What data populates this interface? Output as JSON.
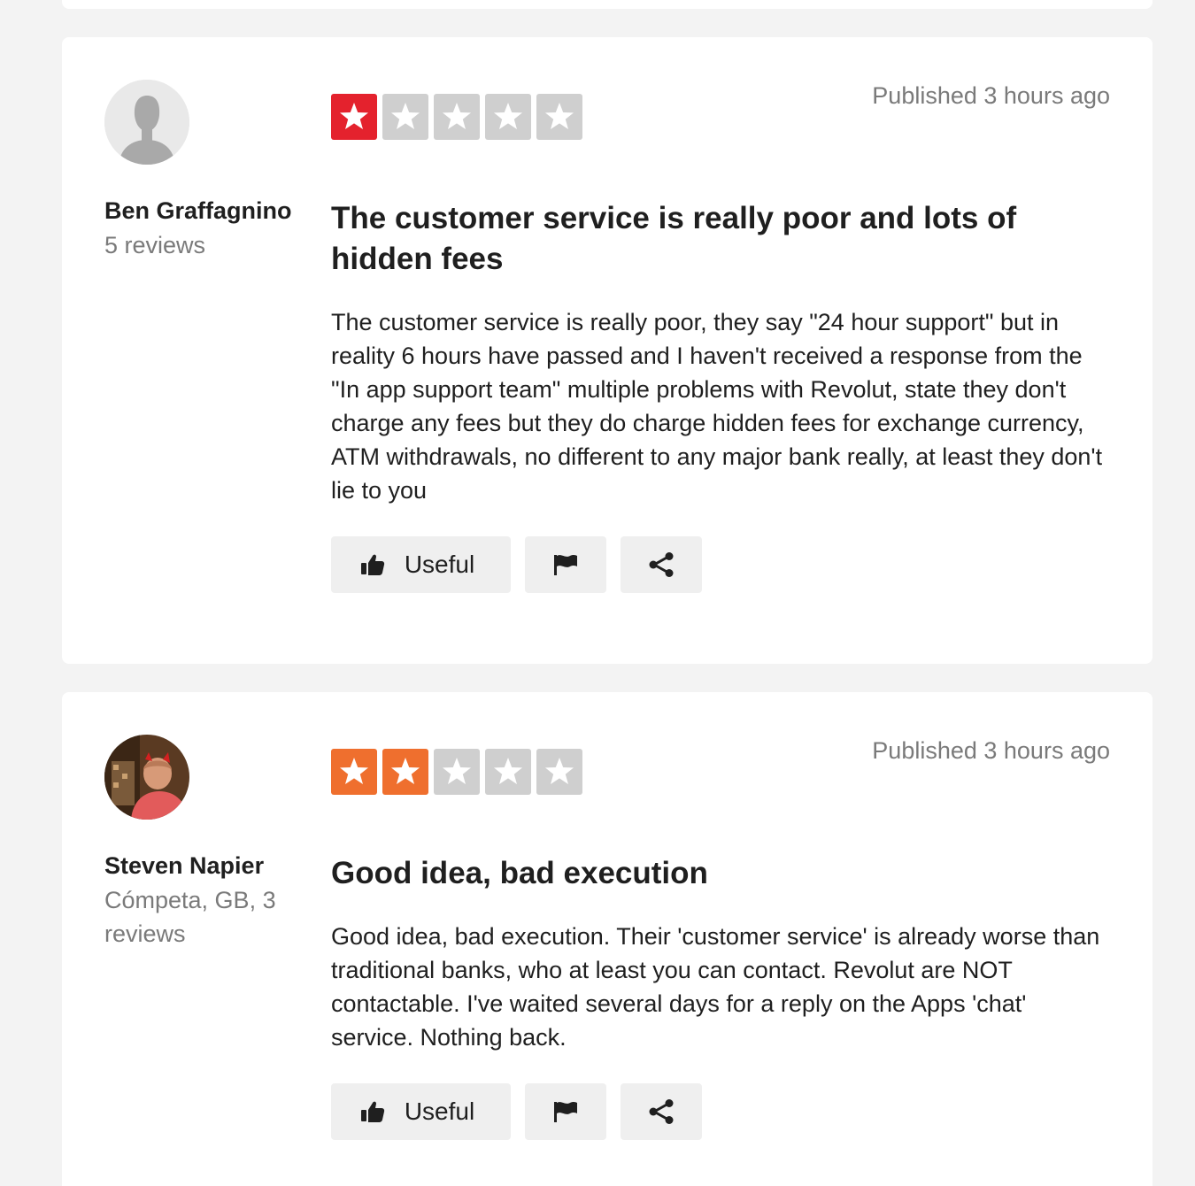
{
  "reviews": [
    {
      "reviewer_name": "Ben Graffagnino",
      "reviewer_meta": "5 reviews",
      "avatar": "default-silhouette",
      "rating": 1,
      "rating_max": 5,
      "rating_color": "#e4222d",
      "published": "Published 3 hours ago",
      "title": "The customer service is really poor and lots of hidden fees",
      "body": "The customer service is really poor, they say \"24 hour support\" but in reality 6 hours have passed and I haven't received a response from the \"In app support team\" multiple problems with Revolut, state they don't charge any fees but they do charge hidden fees for exchange currency, ATM withdrawals, no different to any major bank really, at least they don't lie to you",
      "useful_label": "Useful",
      "icons": [
        "thumbs-up-icon",
        "flag-icon",
        "share-icon"
      ]
    },
    {
      "reviewer_name": "Steven Napier",
      "reviewer_meta": "Cómpeta, GB, 3 reviews",
      "avatar": "user-photo",
      "rating": 2,
      "rating_max": 5,
      "rating_color": "#ef6f2e",
      "published": "Published 3 hours ago",
      "title": "Good idea, bad execution",
      "body": "Good idea, bad execution. Their 'customer service' is already worse than traditional banks, who at least you can contact. Revolut are NOT contactable. I've waited several days for a reply on the Apps 'chat' service. Nothing back.",
      "useful_label": "Useful",
      "icons": [
        "thumbs-up-icon",
        "flag-icon",
        "share-icon"
      ]
    }
  ],
  "colors": {
    "page_bg": "#f3f3f3",
    "empty_star": "#cfcfcf",
    "meta_text": "#7a7a7a"
  }
}
